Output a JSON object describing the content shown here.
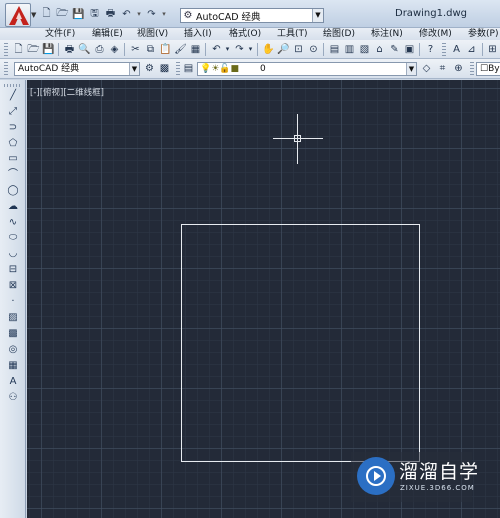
{
  "window": {
    "title": "Drawing1.dwg",
    "workspace": "AutoCAD 经典",
    "quick_access_icons": [
      "new-icon",
      "open-icon",
      "save-icon",
      "save-as-icon",
      "plot-icon",
      "undo-icon",
      "redo-icon"
    ]
  },
  "menu": {
    "items": [
      {
        "id": "file",
        "label": "文件(F)"
      },
      {
        "id": "edit",
        "label": "编辑(E)"
      },
      {
        "id": "view",
        "label": "视图(V)"
      },
      {
        "id": "insert",
        "label": "插入(I)"
      },
      {
        "id": "format",
        "label": "格式(O)"
      },
      {
        "id": "tools",
        "label": "工具(T)"
      },
      {
        "id": "draw",
        "label": "绘图(D)"
      },
      {
        "id": "dimension",
        "label": "标注(N)"
      },
      {
        "id": "modify",
        "label": "修改(M)"
      },
      {
        "id": "parameter",
        "label": "参数(P)"
      }
    ]
  },
  "toolbar2": {
    "style_value": "AutoCAD 经典",
    "layer_value": "0",
    "bylayer": "By"
  },
  "drawing": {
    "view_label": "[-][俯视][二维线框]"
  },
  "watermark": {
    "text": "溜溜自学",
    "url": "ZIXUE.3D66.COM"
  },
  "colors": {
    "canvas": "#232a38",
    "grid": "#465265",
    "entity": "#e8ecf1",
    "logo_red": "#c4221c"
  }
}
